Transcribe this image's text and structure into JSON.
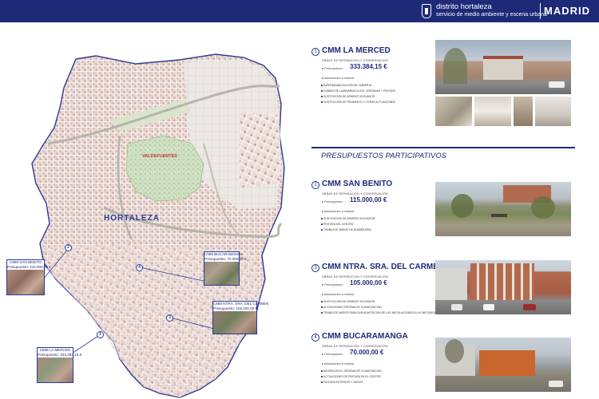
{
  "header": {
    "district": "distrito hortaleza",
    "service": "servicio de medio ambiente y escena urbana",
    "city": "MADRID",
    "crest_icon": "madrid-crest-icon"
  },
  "map": {
    "district_label": "HORTALEZA",
    "park_label": "VALDEFUENTES",
    "callouts": [
      {
        "name": "CMM SAN BENITO",
        "budget_text": "Presupuesto: 115.000,00 €",
        "num": "2"
      },
      {
        "name": "CMM BUCARAMANGA",
        "budget_text": "Presupuesto: 70.000,00 €",
        "num": "4"
      },
      {
        "name": "CMM NTRA. SRA. DEL CARMEN",
        "budget_text": "Presupuesto: 105.000,00 €",
        "num": "3"
      },
      {
        "name": "CMM LA MERCED",
        "budget_text": "Presupuesto: 333.384,15 €",
        "num": "1"
      }
    ]
  },
  "participativos_heading": "PRESUPUESTOS PARTICIPATIVOS",
  "projects": [
    {
      "num": "1",
      "title": "CMM LA MERCED",
      "works": "OBRAS DE REPARACIÓN Y CONSERVACIÓN",
      "budget_label": "▸ Presupuesto:",
      "budget": "333.384,15 €",
      "actions_label": "▸ Actuaciones a realizar",
      "actions": [
        "IMPERMEABILIZACIÓN DE CUBIERTA",
        "CAMBIO DE LUMINARIAS A LED, VENTANAS Y PINTURA",
        "SUSTITUCIÓN DE APARATO ELEVADOR",
        "SUSTITUCIÓN DE PAVIMENTO Y OTRAS ACTUACIONES"
      ]
    },
    {
      "num": "2",
      "title": "CMM SAN BENITO",
      "works": "OBRAS DE REPARACIÓN Y CONSERVACIÓN",
      "budget_label": "▸ Presupuesto:",
      "budget": "115.000,00 €",
      "actions_label": "▸ Actuaciones a realizar",
      "actions": [
        "SUSTITUCIÓN DE APARATO ELEVADOR",
        "PINTURA DEL CENTRO",
        "TRABAJOS VARIOS DE ALBAÑILERÍA"
      ]
    },
    {
      "num": "3",
      "title": "CMM NTRA. SRA. DEL CARMEN",
      "works": "OBRAS DE REPARACIÓN Y CONSERVACIÓN",
      "budget_label": "▸ Presupuesto:",
      "budget": "105.000,00 €",
      "actions_label": "▸ Actuaciones a realizar",
      "actions": [
        "SUSTITUCIÓN DE APARATO ELEVADOR",
        "ACTUACIONES SISTEMA DE CLIMATIZACIÓN",
        "TRABAJOS VARIOS PARA DAR ADAPTACIÓN DE LAS INSTALACIONES A LAS NECESIDADES DEL CENTRO"
      ]
    },
    {
      "num": "4",
      "title": "CMM BUCARAMANGA",
      "works": "OBRAS DE REPARACIÓN Y CONSERVACIÓN",
      "budget_label": "▸ Presupuesto:",
      "budget": "70.000,00 €",
      "actions_label": "▸ Actuaciones a realizar",
      "actions": [
        "MEJORA EN EL SISTEMA DE CLIMATIZACIÓN",
        "ACTUACIONES DE PINTURA EN EL CENTRO",
        "PINTURA EXTERIOR Y VARIOS"
      ]
    }
  ]
}
